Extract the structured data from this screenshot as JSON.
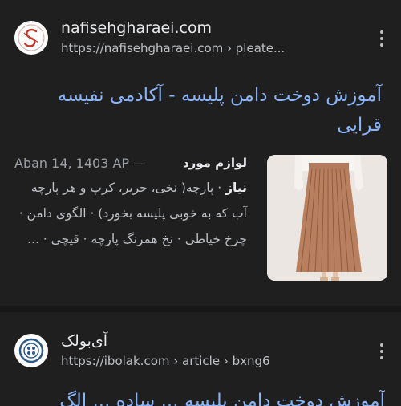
{
  "result1": {
    "site_name": "nafisehgharaei.com",
    "url": "https://nafisehgharaei.com › pleate...",
    "title": "آموزش دوخت دامن پلیسه - آکادمی نفیسه قرایی",
    "date": "Aban 14, 1403 AP —",
    "snippet_label": "لوازم مورد",
    "snippet_bold": "نیاز",
    "snippet": "· پارچه( نخی، حریر، کرپ و هر پارچه آب که به خوبی پلیسه بخورد) · الگوی دامن · چرخ خیاطی · نخ همرنگ پارچه · قیچی · ...",
    "favicon_icon": "s-logo-icon",
    "thumbnail_icon": "pleated-skirt-image"
  },
  "result2": {
    "site_name": "آی‌بولک",
    "url": "https://ibolak.com › article › bxng6",
    "favicon_icon": "button-logo-icon",
    "title_partial": "آموزش دوخت دامن پلیسه ... ساده ... الگ"
  },
  "colors": {
    "background": "#1f1f1f",
    "link": "#8ab4f8",
    "text": "#e8eaed",
    "muted": "#bdc1c6"
  }
}
